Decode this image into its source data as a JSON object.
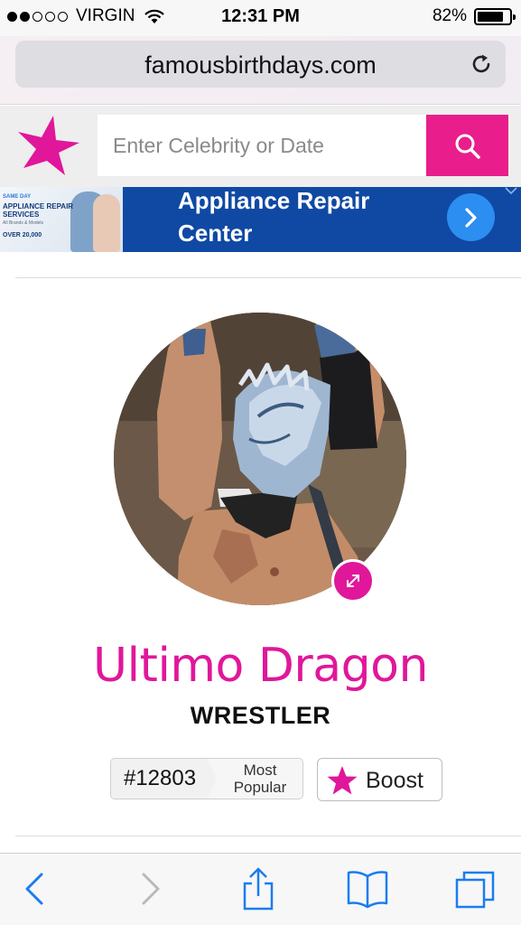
{
  "status_bar": {
    "carrier": "VIRGIN",
    "time": "12:31 PM",
    "battery": "82%",
    "battery_level": 0.82,
    "signal_bars": 2
  },
  "browser": {
    "url": "famousbirthdays.com"
  },
  "site_header": {
    "search_placeholder": "Enter Celebrity or Date",
    "brand_color": "#e91e8c"
  },
  "ad": {
    "title": "Appliance Repair Center",
    "image_text": {
      "tag": "SAME DAY",
      "headline": "APPLIANCE REPAIR SERVICES",
      "sub": "All Brands & Models",
      "count": "OVER 20,000"
    }
  },
  "profile": {
    "name": "Ultimo Dragon",
    "profession": "WRESTLER",
    "rank": "#12803",
    "rank_label": "Most Popular",
    "boost_label": "Boost",
    "accent_color": "#e0179a"
  },
  "toolbar": {
    "icons": [
      "back-icon",
      "forward-icon",
      "share-icon",
      "bookmarks-icon",
      "tabs-icon"
    ],
    "accent_color": "#1a7df0"
  }
}
